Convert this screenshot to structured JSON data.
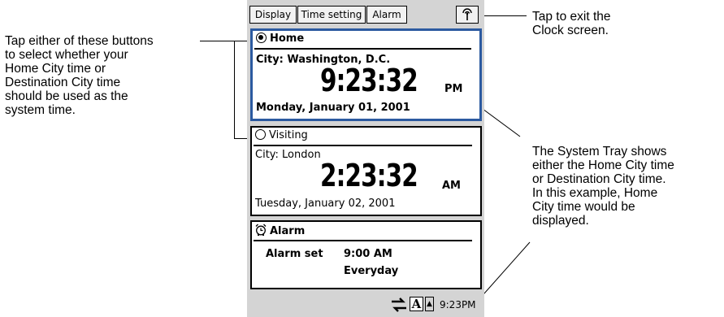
{
  "toolbar": {
    "display_label": "Display",
    "time_setting_label": "Time setting",
    "alarm_label": "Alarm"
  },
  "home": {
    "title": "Home",
    "selected": true,
    "city": "City: Washington, D.C.",
    "time": "9:23:32",
    "ampm": "PM",
    "date": "Monday, January 01, 2001"
  },
  "visiting": {
    "title": "Visiting",
    "selected": false,
    "city": "City: London",
    "time": "2:23:32",
    "ampm": "AM",
    "date": "Tuesday, January 02, 2001"
  },
  "alarm": {
    "title": "Alarm",
    "label": "Alarm set",
    "time": "9:00 AM",
    "repeat": "Everyday"
  },
  "tray": {
    "time": "9:23PM",
    "ime_label": "A",
    "arrow": "▲"
  },
  "annotations": {
    "left": [
      "Tap either of these buttons",
      "to select whether your",
      "Home City time or",
      "Destination City time",
      "should be used as the",
      "system time."
    ],
    "top_right": [
      "Tap to exit the",
      "Clock screen."
    ],
    "bottom_right": [
      "The System Tray shows",
      "either the Home City time",
      "or Destination City time.",
      "In this example, Home",
      "City time would be",
      "displayed."
    ]
  },
  "colors": {
    "active_border": "#2c5aa0",
    "device_bg": "#d4d4d4"
  },
  "icons": [
    "antenna-icon",
    "alarm-clock-icon",
    "connection-icon"
  ]
}
